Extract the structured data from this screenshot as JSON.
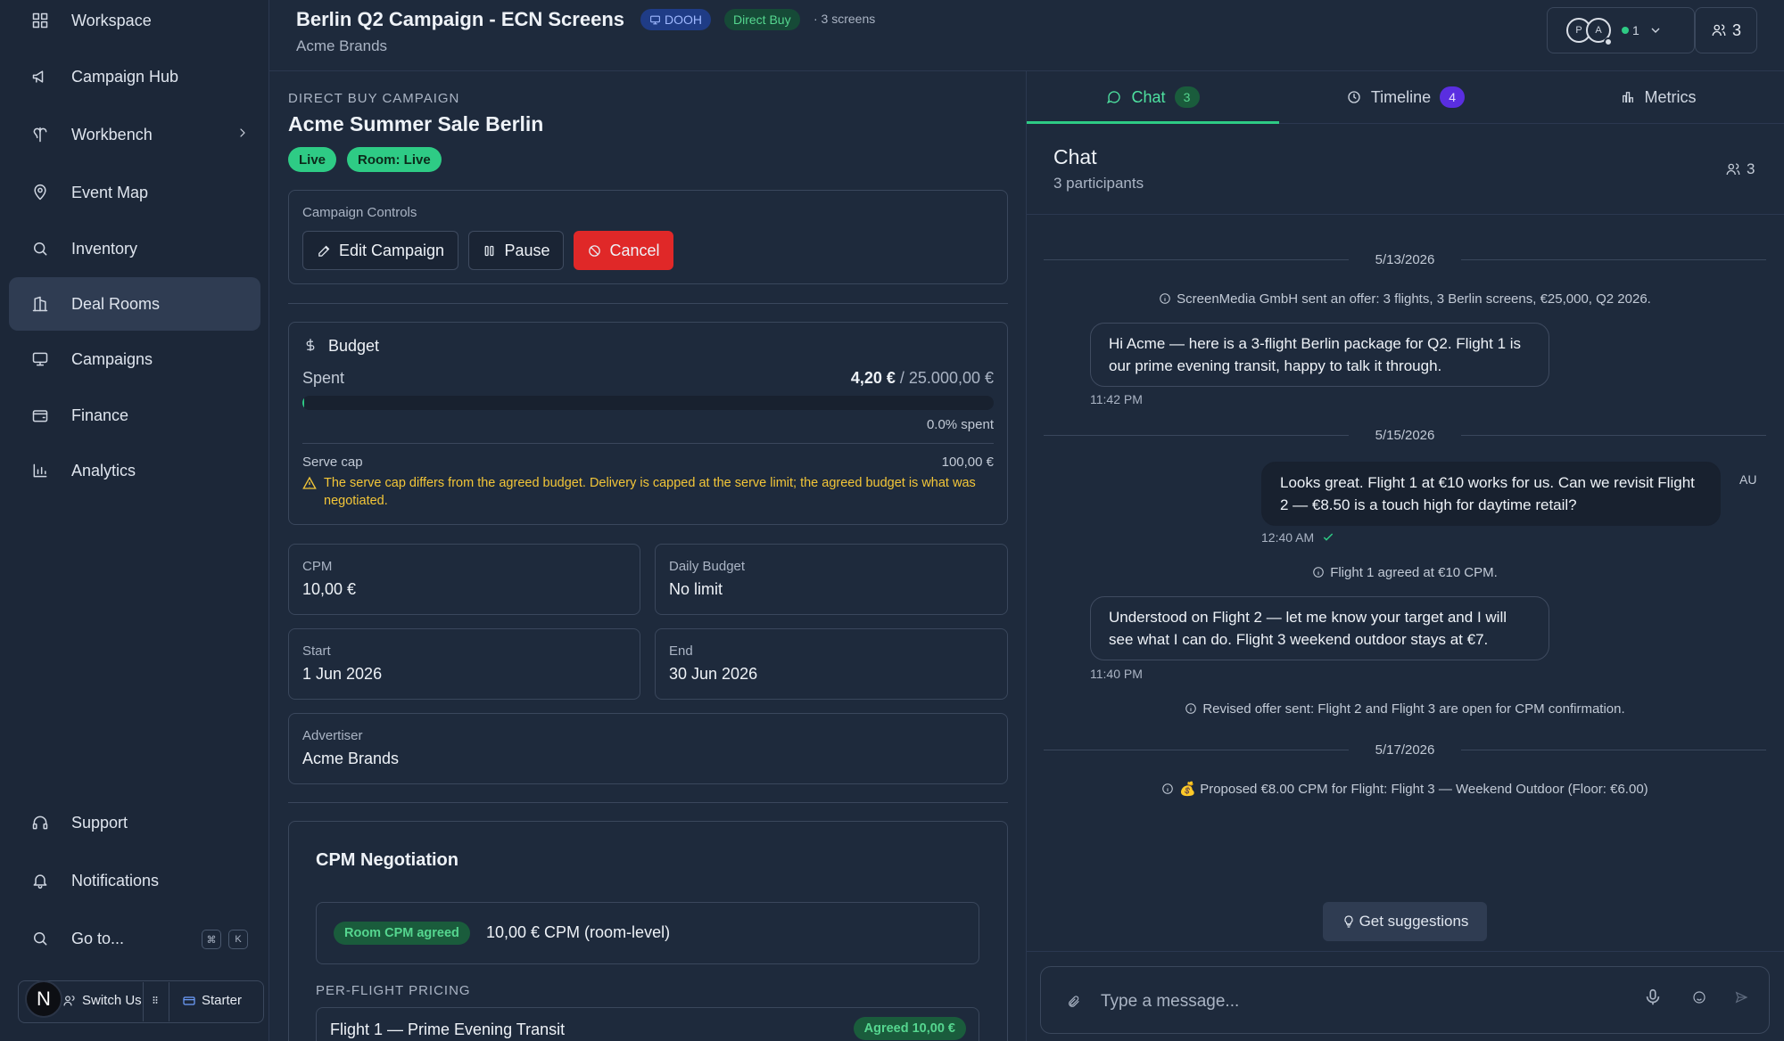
{
  "sidebar": {
    "items": [
      {
        "label": "Workspace",
        "icon": "grid-icon"
      },
      {
        "label": "Campaign Hub",
        "icon": "megaphone-icon"
      },
      {
        "label": "Workbench",
        "icon": "workbench-icon"
      },
      {
        "label": "Event Map",
        "icon": "map-pin-icon"
      },
      {
        "label": "Inventory",
        "icon": "search-icon"
      },
      {
        "label": "Deal Rooms",
        "icon": "deal-room-icon"
      },
      {
        "label": "Campaigns",
        "icon": "monitor-icon"
      },
      {
        "label": "Finance",
        "icon": "wallet-icon"
      },
      {
        "label": "Analytics",
        "icon": "bar-chart-icon"
      }
    ],
    "active": "Deal Rooms",
    "bottom": [
      {
        "label": "Support",
        "icon": "headset-icon"
      },
      {
        "label": "Notifications",
        "icon": "bell-icon"
      },
      {
        "label": "Go to...",
        "icon": "search-icon"
      }
    ],
    "goto_keys": [
      "⌘",
      "K"
    ],
    "user_avatar": "N",
    "switch_user": "Switch Us",
    "plan": "Starter"
  },
  "header": {
    "title": "Berlin Q2 Campaign - ECN Screens",
    "dooh_badge": "DOOH",
    "direct_badge": "Direct Buy",
    "screens": "· 3 screens",
    "subtitle": "Acme Brands",
    "presence_avatars": [
      "P",
      "A"
    ],
    "online_count": "1",
    "participants_count": "3"
  },
  "campaign": {
    "section_label": "DIRECT BUY CAMPAIGN",
    "name": "Acme Summer Sale Berlin",
    "status": "Live",
    "room_status": "Room: Live",
    "controls_label": "Campaign Controls",
    "edit_label": "Edit Campaign",
    "pause_label": "Pause",
    "cancel_label": "Cancel",
    "budget": {
      "title": "Budget",
      "spent_label": "Spent",
      "spent_value": "4,20 €",
      "spent_total": " / 25.000,00 €",
      "percent_label": "0.0% spent",
      "spent_fraction": 0.0002,
      "serve_cap_label": "Serve cap",
      "serve_cap_value": "100,00 €",
      "warning": "The serve cap differs from the agreed budget. Delivery is capped at the serve limit; the agreed budget is what was negotiated."
    },
    "cpm_label": "CPM",
    "cpm_value": "10,00 €",
    "daily_label": "Daily Budget",
    "daily_value": "No limit",
    "start_label": "Start",
    "start_value": "1 Jun 2026",
    "end_label": "End",
    "end_value": "30 Jun 2026",
    "advertiser_label": "Advertiser",
    "advertiser_value": "Acme Brands",
    "negotiation": {
      "title": "CPM Negotiation",
      "agreed_badge": "Room CPM agreed",
      "agreed_value": "10,00 € CPM (room-level)",
      "per_flight_label": "PER-FLIGHT PRICING",
      "flights": [
        {
          "name": "Flight 1 — Prime Evening Transit",
          "status": "Agreed 10,00 €"
        }
      ]
    }
  },
  "tabs": [
    {
      "label": "Chat",
      "count": "3",
      "icon": "chat-icon"
    },
    {
      "label": "Timeline",
      "count": "4",
      "icon": "clock-icon"
    },
    {
      "label": "Metrics",
      "count": "",
      "icon": "bar-chart-icon"
    }
  ],
  "chat": {
    "title": "Chat",
    "participants": "3 participants",
    "participant_count": "3",
    "dates": [
      "5/13/2026",
      "5/15/2026",
      "5/17/2026"
    ],
    "system": [
      "ScreenMedia GmbH sent an offer: 3 flights, 3 Berlin screens, €25,000, Q2 2026.",
      "Flight 1 agreed at €10 CPM.",
      "Revised offer sent: Flight 2 and Flight 3 are open for CPM confirmation.",
      "💰 Proposed €8.00 CPM for Flight: Flight 3 — Weekend Outdoor (Floor: €6.00)"
    ],
    "messages": [
      {
        "text": "Hi Acme — here is a 3-flight Berlin package for Q2. Flight 1 is our prime evening transit, happy to talk it through.",
        "time": "11:42 PM"
      },
      {
        "text": "Looks great. Flight 1 at €10 works for us. Can we revisit Flight 2 — €8.50 is a touch high for daytime retail?",
        "time": "12:40 AM",
        "author": "AU"
      },
      {
        "text": "Understood on Flight 2 — let me know your target and I will see what I can do. Flight 3 weekend outdoor stays at €7.",
        "time": "11:40 PM"
      }
    ],
    "suggest_label": "Get suggestions",
    "placeholder": "Type a message..."
  },
  "colors": {
    "accent": "#2ecb85",
    "danger": "#e02828",
    "warning": "#f3c638",
    "background": "#1e2a3c"
  }
}
